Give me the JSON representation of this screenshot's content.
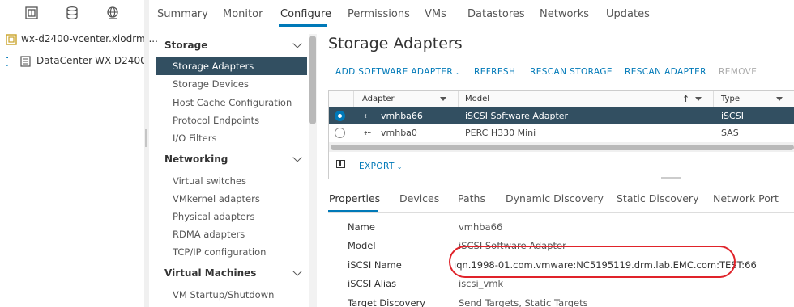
{
  "inventory": {
    "toolbar_icons": [
      "hosts-clusters-icon",
      "storage-icon",
      "network-icon"
    ],
    "tree": [
      {
        "label": "wx-d2400-vcenter.xiodrm....",
        "icon": "vcenter-icon"
      },
      {
        "label": "DataCenter-WX-D2400",
        "icon": "datacenter-icon"
      }
    ]
  },
  "tabs": [
    "Summary",
    "Monitor",
    "Configure",
    "Permissions",
    "VMs",
    "Datastores",
    "Networks",
    "Updates"
  ],
  "active_tab": "Configure",
  "sidenav": {
    "groups": [
      {
        "label": "Storage",
        "items": [
          "Storage Adapters",
          "Storage Devices",
          "Host Cache Configuration",
          "Protocol Endpoints",
          "I/O Filters"
        ]
      },
      {
        "label": "Networking",
        "items": [
          "Virtual switches",
          "VMkernel adapters",
          "Physical adapters",
          "RDMA adapters",
          "TCP/IP configuration"
        ]
      },
      {
        "label": "Virtual Machines",
        "items": [
          "VM Startup/Shutdown"
        ]
      }
    ],
    "selected": "Storage Adapters"
  },
  "main": {
    "title": "Storage Adapters",
    "actions": [
      {
        "label": "ADD SOFTWARE ADAPTER",
        "dropdown": true,
        "enabled": true
      },
      {
        "label": "REFRESH",
        "enabled": true
      },
      {
        "label": "RESCAN STORAGE",
        "enabled": true
      },
      {
        "label": "RESCAN ADAPTER",
        "enabled": true
      },
      {
        "label": "REMOVE",
        "enabled": false
      }
    ],
    "grid": {
      "columns": [
        "Adapter",
        "Model",
        "Type"
      ],
      "rows": [
        {
          "adapter": "vmhba66",
          "model": "iSCSI Software Adapter",
          "type": "iSCSI",
          "selected": true
        },
        {
          "adapter": "vmhba0",
          "model": "PERC H330 Mini",
          "type": "SAS",
          "selected": false
        }
      ],
      "export_label": "EXPORT"
    },
    "detail_tabs": [
      "Properties",
      "Devices",
      "Paths",
      "Dynamic Discovery",
      "Static Discovery",
      "Network Port"
    ],
    "active_detail_tab": "Properties",
    "properties": [
      {
        "key": "Name",
        "value": "vmhba66"
      },
      {
        "key": "Model",
        "value": "iSCSI Software Adapter"
      },
      {
        "key": "iSCSI Name",
        "value": "ıqn.1998-01.com.vmware:NC5195119.drm.lab.EMC.com:TEST:66"
      },
      {
        "key": "iSCSI Alias",
        "value": "iscsi_vmk"
      },
      {
        "key": "Target Discovery",
        "value": "Send Targets, Static Targets"
      }
    ]
  },
  "colors": {
    "accent": "#0079b8",
    "selection": "#324f61",
    "annotation": "#e0232a"
  }
}
